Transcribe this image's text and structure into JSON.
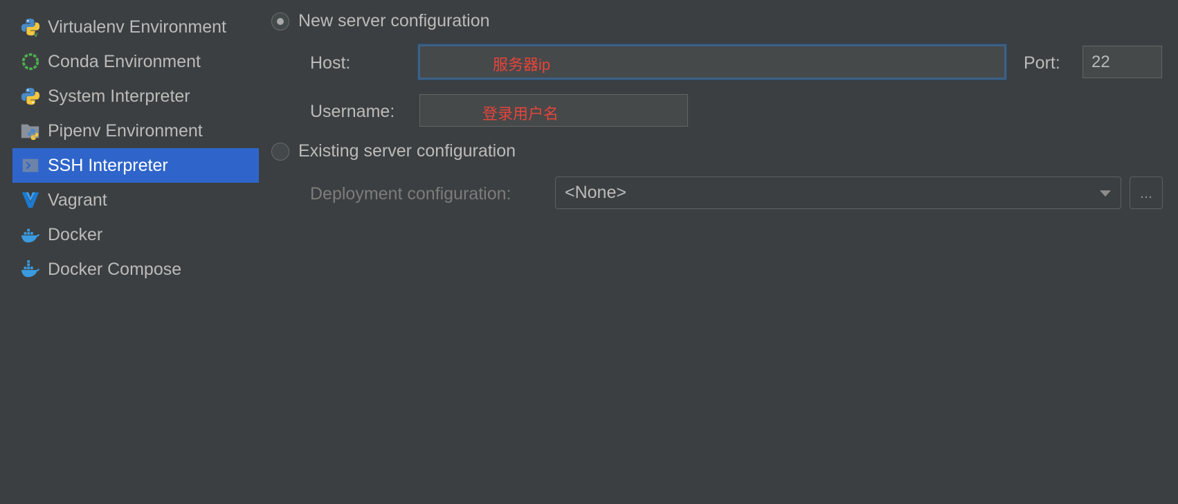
{
  "sidebar": {
    "items": [
      {
        "label": "Virtualenv Environment",
        "icon": "python-virtualenv-icon"
      },
      {
        "label": "Conda Environment",
        "icon": "conda-icon"
      },
      {
        "label": "System Interpreter",
        "icon": "python-icon"
      },
      {
        "label": "Pipenv Environment",
        "icon": "pipenv-icon"
      },
      {
        "label": "SSH Interpreter",
        "icon": "ssh-terminal-icon",
        "selected": true
      },
      {
        "label": "Vagrant",
        "icon": "vagrant-icon"
      },
      {
        "label": "Docker",
        "icon": "docker-icon"
      },
      {
        "label": "Docker Compose",
        "icon": "docker-compose-icon"
      }
    ]
  },
  "new_server": {
    "radio_label": "New server configuration",
    "checked": true,
    "host_label": "Host:",
    "host_value": "",
    "host_annotation": "服务器ip",
    "port_label": "Port:",
    "port_value": "22",
    "username_label": "Username:",
    "username_value": "",
    "username_annotation": "登录用户名"
  },
  "existing_server": {
    "radio_label": "Existing server configuration",
    "checked": false,
    "deployment_label": "Deployment configuration:",
    "deployment_value": "<None>",
    "browse_label": "..."
  },
  "colors": {
    "background": "#3c3f41",
    "selection": "#2f65ca",
    "annotation": "#e8443a",
    "focus_border": "#3d6185"
  }
}
